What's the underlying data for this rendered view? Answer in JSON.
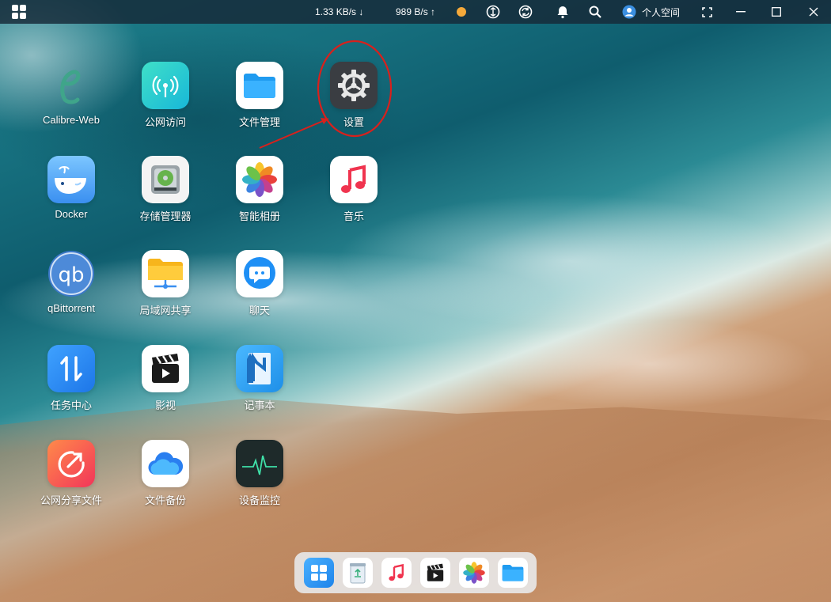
{
  "topbar": {
    "download_speed": "1.33 KB/s ↓",
    "upload_speed": "989 B/s ↑",
    "user_label": "个人空间"
  },
  "apps": [
    {
      "label": "Calibre-Web",
      "icon": "calibre-web-icon"
    },
    {
      "label": "公网访问",
      "icon": "public-access-icon"
    },
    {
      "label": "文件管理",
      "icon": "folder-icon"
    },
    {
      "label": "设置",
      "icon": "gear-icon"
    },
    {
      "label": "Docker",
      "icon": "docker-whale-icon"
    },
    {
      "label": "存储管理器",
      "icon": "hard-disk-icon"
    },
    {
      "label": "智能相册",
      "icon": "photos-icon"
    },
    {
      "label": "音乐",
      "icon": "music-note-icon"
    },
    {
      "label": "qBittorrent",
      "icon": "qbittorrent-icon"
    },
    {
      "label": "局域网共享",
      "icon": "lan-share-icon"
    },
    {
      "label": "聊天",
      "icon": "chat-bubble-icon"
    },
    {
      "label": "任务中心",
      "icon": "transfer-arrows-icon"
    },
    {
      "label": "影视",
      "icon": "clapperboard-icon"
    },
    {
      "label": "记事本",
      "icon": "notepad-icon"
    },
    {
      "label": "公网分享文件",
      "icon": "share-arrow-icon"
    },
    {
      "label": "文件备份",
      "icon": "cloud-backup-icon"
    },
    {
      "label": "设备监控",
      "icon": "monitor-pulse-icon"
    }
  ],
  "dock": [
    "app-grid-icon",
    "recycle-bin-icon",
    "music-note-icon",
    "clapperboard-icon",
    "photos-icon",
    "folder-icon"
  ],
  "colors": {
    "annotation": "#d9201c",
    "topbar": "#16283a",
    "accent": "#f4a93a"
  }
}
